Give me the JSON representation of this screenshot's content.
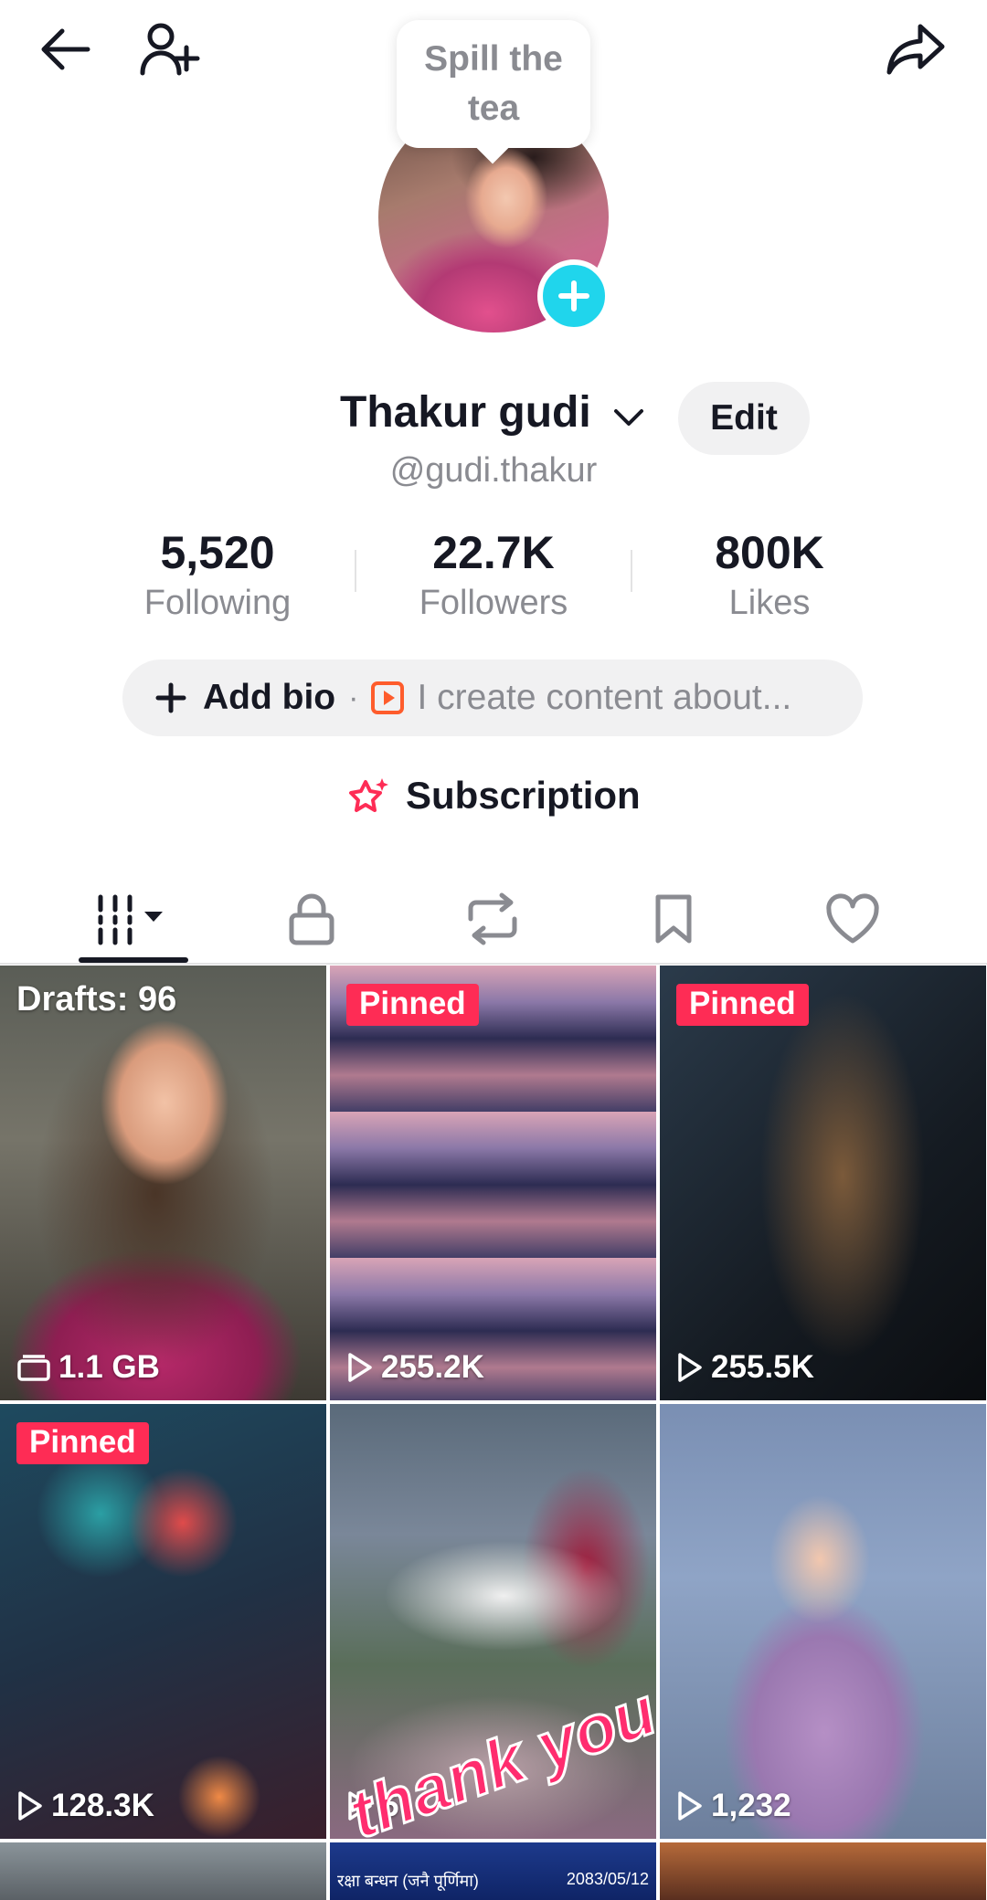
{
  "header": {
    "back_icon": "arrow-left-icon",
    "add_friend_icon": "person-plus-icon",
    "share_icon": "share-arrow-icon"
  },
  "bubble": {
    "text": "Spill the tea"
  },
  "profile": {
    "display_name": "Thakur gudi",
    "username": "@gudi.thakur",
    "edit_label": "Edit"
  },
  "stats": [
    {
      "value": "5,520",
      "label": "Following"
    },
    {
      "value": "22.7K",
      "label": "Followers"
    },
    {
      "value": "800K",
      "label": "Likes"
    }
  ],
  "bio": {
    "add_label": "Add bio",
    "separator": "·",
    "placeholder": "I create content about..."
  },
  "subscription": {
    "label": "Subscription"
  },
  "tabs": [
    {
      "icon": "grid-icon"
    },
    {
      "icon": "lock-icon"
    },
    {
      "icon": "repost-icon"
    },
    {
      "icon": "bookmark-icon"
    },
    {
      "icon": "heart-icon"
    }
  ],
  "videos": [
    {
      "badge": "Drafts: 96",
      "stat": "1.1 GB"
    },
    {
      "badge": "Pinned",
      "stat": "255.2K"
    },
    {
      "badge": "Pinned",
      "stat": "255.5K"
    },
    {
      "badge": "Pinned",
      "stat": "128.3K"
    },
    {
      "badge": "",
      "stat": "5",
      "overlay": "thank you"
    },
    {
      "badge": "",
      "stat": "1,232"
    }
  ],
  "partial_row": {
    "cell_8_lines": [
      "रक्षा बन्धन (जनै पूर्णिमा)",
      "2083/05/12"
    ]
  },
  "colors": {
    "accent": "#fe2c55",
    "avatar_plus": "#20d5ec",
    "text_primary": "#161823",
    "text_secondary": "#8a8b91"
  }
}
